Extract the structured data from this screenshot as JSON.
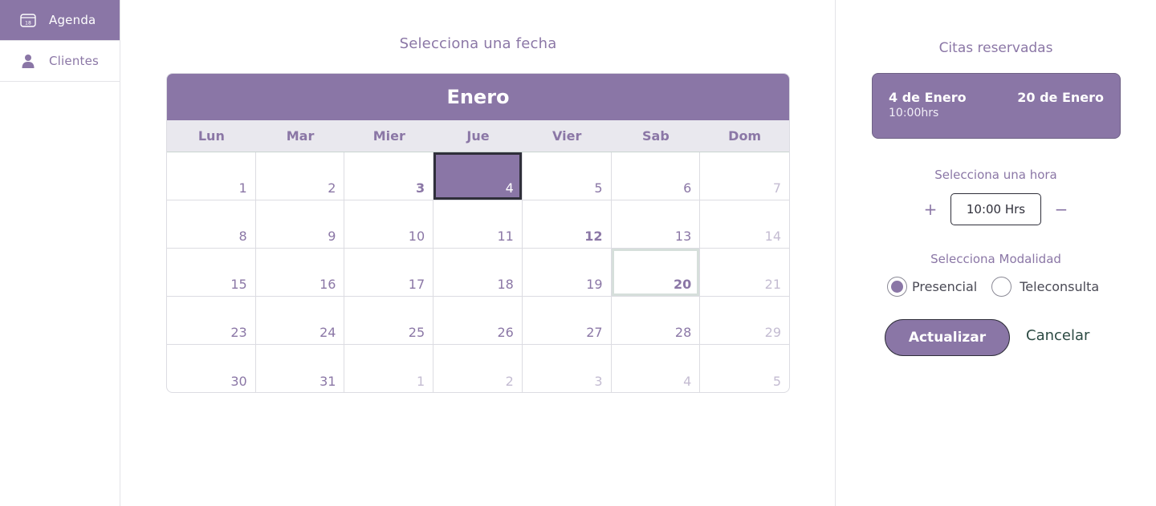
{
  "sidebar": {
    "items": [
      {
        "label": "Agenda",
        "icon": "calendar-icon",
        "active": true
      },
      {
        "label": "Clientes",
        "icon": "user-icon",
        "active": false
      }
    ]
  },
  "main": {
    "title": "Selecciona una fecha",
    "calendar": {
      "month": "Enero",
      "weekdays": [
        "Lun",
        "Mar",
        "Mier",
        "Jue",
        "Vier",
        "Sab",
        "Dom"
      ],
      "days": [
        {
          "n": "1",
          "state": "normal"
        },
        {
          "n": "2",
          "state": "normal"
        },
        {
          "n": "3",
          "state": "bold"
        },
        {
          "n": "4",
          "state": "selected"
        },
        {
          "n": "5",
          "state": "normal"
        },
        {
          "n": "6",
          "state": "normal"
        },
        {
          "n": "7",
          "state": "muted"
        },
        {
          "n": "8",
          "state": "normal"
        },
        {
          "n": "9",
          "state": "normal"
        },
        {
          "n": "10",
          "state": "normal"
        },
        {
          "n": "11",
          "state": "normal"
        },
        {
          "n": "12",
          "state": "bold"
        },
        {
          "n": "13",
          "state": "normal"
        },
        {
          "n": "14",
          "state": "muted"
        },
        {
          "n": "15",
          "state": "normal"
        },
        {
          "n": "16",
          "state": "normal"
        },
        {
          "n": "17",
          "state": "normal"
        },
        {
          "n": "18",
          "state": "normal"
        },
        {
          "n": "19",
          "state": "normal"
        },
        {
          "n": "20",
          "state": "outlined"
        },
        {
          "n": "21",
          "state": "muted"
        },
        {
          "n": "23",
          "state": "normal"
        },
        {
          "n": "24",
          "state": "normal"
        },
        {
          "n": "25",
          "state": "normal"
        },
        {
          "n": "26",
          "state": "normal"
        },
        {
          "n": "27",
          "state": "normal"
        },
        {
          "n": "28",
          "state": "normal"
        },
        {
          "n": "29",
          "state": "muted"
        },
        {
          "n": "30",
          "state": "normal"
        },
        {
          "n": "31",
          "state": "normal"
        },
        {
          "n": "1",
          "state": "muted"
        },
        {
          "n": "2",
          "state": "muted"
        },
        {
          "n": "3",
          "state": "muted"
        },
        {
          "n": "4",
          "state": "muted"
        },
        {
          "n": "5",
          "state": "muted"
        }
      ]
    }
  },
  "panel": {
    "title": "Citas reservadas",
    "booked": {
      "date_start": "4 de Enero",
      "date_end": "20 de Enero",
      "time": "10:00hrs"
    },
    "time_label": "Selecciona una hora",
    "time_value": "10:00 Hrs",
    "plus": "+",
    "minus": "−",
    "mode_label": "Selecciona Modalidad",
    "modes": [
      {
        "label": "Presencial",
        "selected": true
      },
      {
        "label": "Teleconsulta",
        "selected": false
      }
    ],
    "primary_button": "Actualizar",
    "cancel_link": "Cancelar"
  },
  "colors": {
    "accent": "#8a76a6",
    "text_purple": "#8b77a6",
    "dark_border": "#2f2f3a",
    "cancel_green": "#2c4a43"
  }
}
